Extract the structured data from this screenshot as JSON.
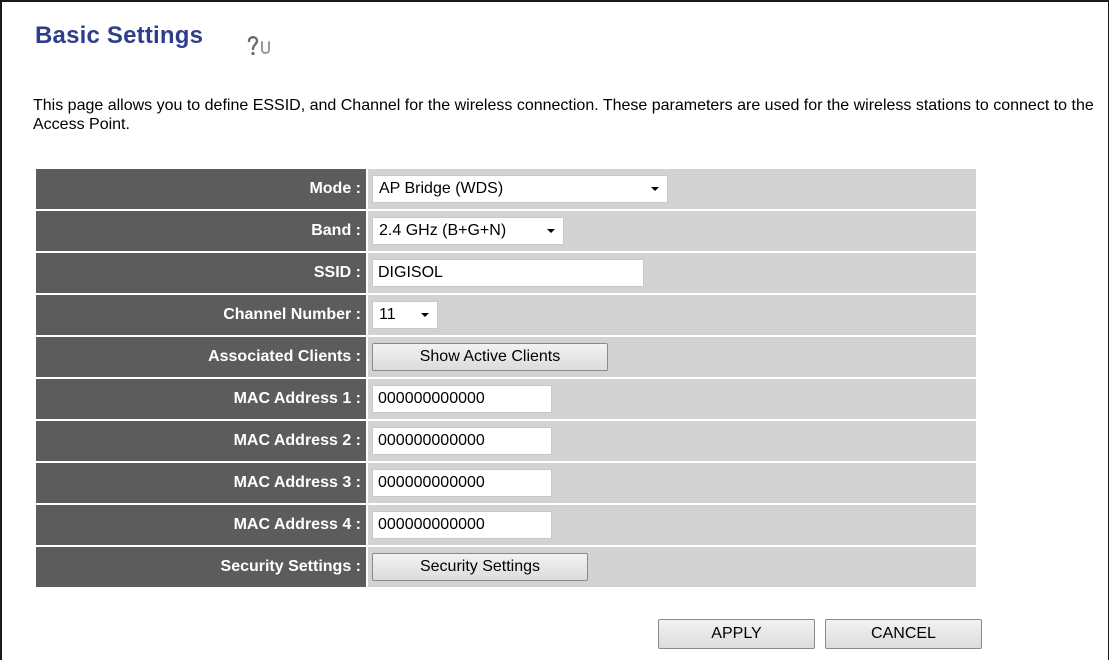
{
  "page": {
    "title": "Basic Settings",
    "description": "This page allows you to define ESSID, and Channel for the wireless connection. These parameters are used for the wireless stations to connect to the Access Point."
  },
  "form": {
    "mode": {
      "label": "Mode :",
      "value": "AP Bridge (WDS)"
    },
    "band": {
      "label": "Band :",
      "value": "2.4 GHz (B+G+N)"
    },
    "ssid": {
      "label": "SSID :",
      "value": "DIGISOL"
    },
    "channel": {
      "label": "Channel Number :",
      "value": "11"
    },
    "associated_clients": {
      "label": "Associated Clients :",
      "button": "Show Active Clients"
    },
    "mac1": {
      "label": "MAC Address 1 :",
      "value": "000000000000"
    },
    "mac2": {
      "label": "MAC Address 2 :",
      "value": "000000000000"
    },
    "mac3": {
      "label": "MAC Address 3 :",
      "value": "000000000000"
    },
    "mac4": {
      "label": "MAC Address 4 :",
      "value": "000000000000"
    },
    "security": {
      "label": "Security Settings :",
      "button": "Security Settings"
    }
  },
  "actions": {
    "apply": "APPLY",
    "cancel": "CANCEL"
  },
  "icons": {
    "help": "help-icon"
  },
  "colors": {
    "title": "#2e3e8c",
    "label_bg": "#5c5c5c",
    "value_bg": "#d2d2d2"
  }
}
